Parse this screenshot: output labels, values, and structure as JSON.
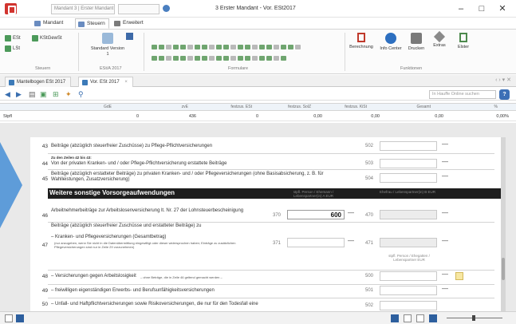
{
  "window": {
    "mandant_field": "Mandant 3 | Erster Mandant",
    "search_field": "",
    "title": "3 Erster Mandant - Vor. ESt2017",
    "minimize": "–",
    "maximize": "□",
    "close": "✕"
  },
  "ribbon_tabs": [
    {
      "label": "Mandant"
    },
    {
      "label": "Steuern"
    },
    {
      "label": "Erweitert"
    }
  ],
  "ribbon": {
    "steuern_group": {
      "label": "Steuern",
      "items": [
        "ESt",
        "KStGewSt",
        "LSt"
      ]
    },
    "esta_group": {
      "label": "ESt/A 2017",
      "standard_label": "Standard Version 1"
    },
    "formulare_group": {
      "label": "Formulare"
    },
    "funktionen_group": {
      "label": "Funktionen",
      "buttons": [
        "Berechnung",
        "Info Center",
        "Drucken",
        "Extras",
        "Elster"
      ]
    }
  },
  "doc_tabs": [
    {
      "label": "Mantelbogen ESt 2017"
    },
    {
      "label": "Vor. ESt 2017"
    }
  ],
  "toolbar": {
    "search_placeholder": "In Hauffe Online suchen",
    "help": "?"
  },
  "grid": {
    "headers": [
      "GdE",
      "zvE",
      "festzus. ESt",
      "festzus. SolZ",
      "festzus. KiSt",
      "Gesamt",
      "%"
    ],
    "row": {
      "label": "Stpfl",
      "values": [
        "0",
        "436",
        "0",
        "0,00",
        "0,00",
        "0,00",
        "0,00%"
      ]
    }
  },
  "form": {
    "section_title": "Weitere sonstige Vorsorgeaufwendungen",
    "col_header_left": "stpfl. Person / Ehemann / Lebenspartner(in) A EUR",
    "col_header_right": "Ehefrau / Lebenspartner(in) B EUR",
    "col_header_right2": "stpfl. Person / Ehegatten / Lebenspartner EUR",
    "rows": [
      {
        "num": "43",
        "text": "Beiträge (abzüglich steuerfreier Zuschüsse) zu Pflege-Pflichtversicherungen",
        "code": "502"
      },
      {
        "num": "44",
        "pretext": "Zu den Zeilen 42 bis 43:",
        "text": "Von der privaten Kranken- und / oder Pflege-Pflichtversicherung erstattete Beiträge",
        "code": "503"
      },
      {
        "num": "45",
        "text": "Beiträge (abzüglich erstatteter Beiträge) zu privaten Kranken- und / oder Pflegeversicherungen (ohne Basisabsicherung, z. B. für Wahlleistungen, Zusatzversicherung)",
        "code": "504"
      },
      {
        "num": "46",
        "text": "Arbeitnehmerbeiträge zur Arbeitslosenversicherung lt. Nr. 27 der Lohnsteuerbescheinigung",
        "code_a": "370",
        "value_a": "600",
        "code_b": "470"
      },
      {
        "num": "47",
        "pretext": "Beiträge (abzüglich steuerfreier Zuschüsse und erstatteter Beiträge) zu",
        "text": "– Kranken- und Pflegeversicherungen (Gesamtbetrag)",
        "note": "(nur anzugeben, wenn Sie nicht in die Datenübermittlung eingewilligt oder dieser widersprochen haben; Einträge zu zusätzlichen Pflegeversicherungen sind nur in Zeile 29 vorzunehmen)",
        "code_a": "371",
        "code_b": "471"
      },
      {
        "num": "48",
        "text": "– Versicherungen gegen Arbeitslosigkeit",
        "note": "– ohne Beträge, die in Zeile 46 geltend gemacht werden –",
        "code": "500"
      },
      {
        "num": "49",
        "text": "– freiwilligen eigenständigen Erwerbs- und Berufsunfähigkeitsversicherungen",
        "code": "501"
      },
      {
        "num": "50",
        "text": "– Unfall- und Haftpflichtversicherungen sowie Risikoversicherungen, die nur für den Todesfall eine",
        "code": "502"
      }
    ]
  },
  "colors": {
    "accent": "#3c6fb6",
    "section_bar": "#1e1e1e",
    "arrow": "#5e9cd9",
    "logo": "#d1342f"
  }
}
